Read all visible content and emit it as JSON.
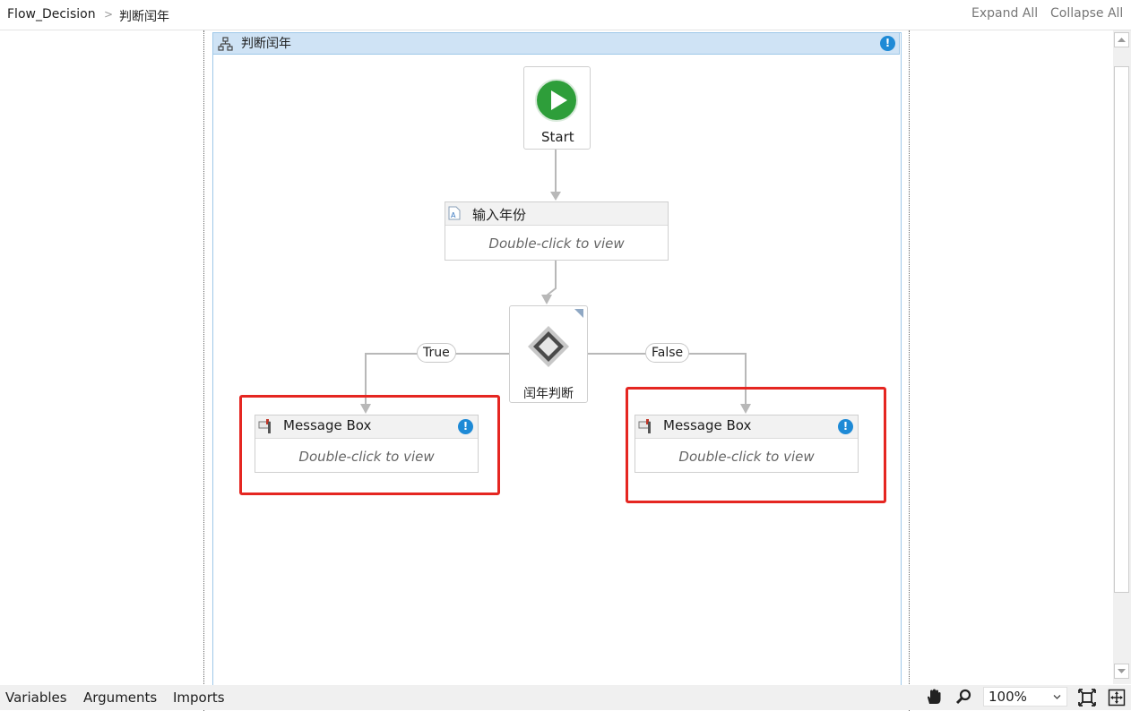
{
  "breadcrumb": {
    "root": "Flow_Decision",
    "separator": ">",
    "current": "判断闰年"
  },
  "header": {
    "expand_all": "Expand All",
    "collapse_all": "Collapse All"
  },
  "flowchart": {
    "title": "判断闰年",
    "icon": "flowchart-icon",
    "warning_icon": "warning-icon"
  },
  "nodes": {
    "start": {
      "label": "Start",
      "icon": "play-icon"
    },
    "input_dialog": {
      "title": "输入年份",
      "hint": "Double-click to view",
      "icon": "input-dialog-icon"
    },
    "decision": {
      "label": "闰年判断",
      "icon": "decision-diamond-icon"
    },
    "message_true": {
      "title": "Message Box",
      "hint": "Double-click to view",
      "icon": "message-box-icon",
      "warning_icon": "warning-icon"
    },
    "message_false": {
      "title": "Message Box",
      "hint": "Double-click to view",
      "icon": "message-box-icon",
      "warning_icon": "warning-icon"
    }
  },
  "branches": {
    "true_label": "True",
    "false_label": "False"
  },
  "statusbar": {
    "variables": "Variables",
    "arguments": "Arguments",
    "imports": "Imports",
    "zoom": "100%",
    "icons": [
      "hand-pan-icon",
      "zoom-search-icon",
      "fit-to-screen-icon",
      "overview-icon"
    ]
  },
  "colors": {
    "start_green": "#2e9e3a",
    "title_bar": "#cfe3f5",
    "highlight_red": "#e52621",
    "warning_blue": "#1e8ad6"
  }
}
